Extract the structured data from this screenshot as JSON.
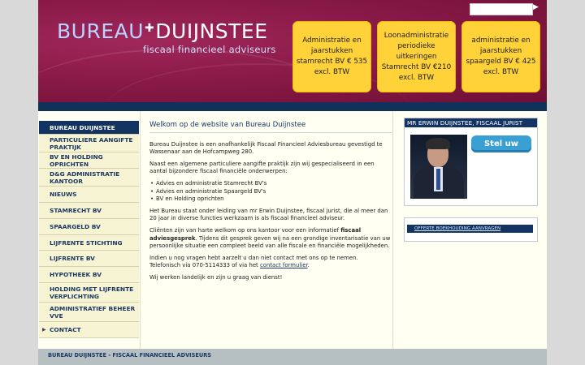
{
  "header": {
    "logo_part1": "BUREAU",
    "logo_part2": "DUIJNSTEE",
    "logo_tagline": "fiscaal financieel adviseurs",
    "search": {
      "placeholder": ""
    },
    "promos": [
      {
        "text": "Administratie en jaarstukken stamrecht BV € 535 excl. BTW"
      },
      {
        "text": "Loonadministratie periodieke uitkeringen Stamrecht BV €210 excl. BTW"
      },
      {
        "text": "administratie en jaarstukken spaargeld BV € 425 excl. BTW"
      }
    ]
  },
  "sidebar": {
    "items": [
      {
        "label": "BUREAU DUIJNSTEE"
      },
      {
        "label": "PARTICULIERE AANGIFTE PRAKTIJK"
      },
      {
        "label": "BV EN HOLDING OPRICHTEN"
      },
      {
        "label": "D&G ADMINISTRATIE KANTOOR"
      },
      {
        "label": "NIEUWS"
      },
      {
        "label": "STAMRECHT BV"
      },
      {
        "label": "SPAARGELD BV"
      },
      {
        "label": "LIJFRENTE STICHTING"
      },
      {
        "label": "LIJFRENTE BV"
      },
      {
        "label": "HYPOTHEEK BV"
      },
      {
        "label": "HOLDING MET LIJFRENTE VERPLICHTING"
      },
      {
        "label": "ADMINISTRATIEF BEHEER VVE"
      },
      {
        "label": "CONTACT"
      }
    ]
  },
  "main": {
    "title": "Welkom op de website van Bureau Duijnstee",
    "p1": "Bureau Duijnstee is een onafhankelijk Fiscaal Financieel Adviesbureau gevestigd te Wassenaar aan de Hofcampweg 280.",
    "p2": "Naast een algemene particuliere aangifte praktijk zijn wij gespecialiseerd in een aantal bijzondere fiscaal financiële onderwerpen:",
    "bullets": [
      "Advies en administratie Stamrecht BV's",
      "Advies en administratie Spaargeld BV's",
      "BV en Holding oprichten"
    ],
    "p3": "Het Bureau staat onder leiding van mr Erwin Duijnstee, fiscaal jurist, die al meer dan 20 jaar in diverse functies werkzaam is als fiscaal financieel adviseur.",
    "p4_a": "Cliënten zijn van harte welkom op ons kantoor voor een informatief ",
    "p4_strong": "fiscaal adviesgesprek",
    "p4_b": ". Tijdens dit gesprek geven wij na een grondige inventarisatie van uw persoonlijke situatie een compleet beeld van alle fiscale en financiële mogelijkheden.",
    "p5_line1": "Indien u nog vragen hebt aarzelt u dan niet contact met ons op te nemen.",
    "p5_line2_a": "Telefonisch via 070-5114333 of via het ",
    "p5_link": "contact formulier",
    "p5_line2_b": ".",
    "p6": "Wij werken landelijk en zijn u graag van dienst!"
  },
  "right": {
    "box_title": "MR ERWIN DUIJNSTEE, FISCAAL JURIST",
    "ask_button": "Stel uw vraag",
    "offer_link": "OFFERTE BOEKHOUDING AANVRAGEN"
  },
  "footer": {
    "text": "BUREAU DUIJNSTEE - FISCAAL FINANCIEEL ADVISEURS"
  },
  "colors": {
    "brand_maroon": "#8a1a48",
    "navy": "#133463",
    "promo_yellow": "#ffd23a",
    "ask_blue": "#3aa0d4"
  }
}
